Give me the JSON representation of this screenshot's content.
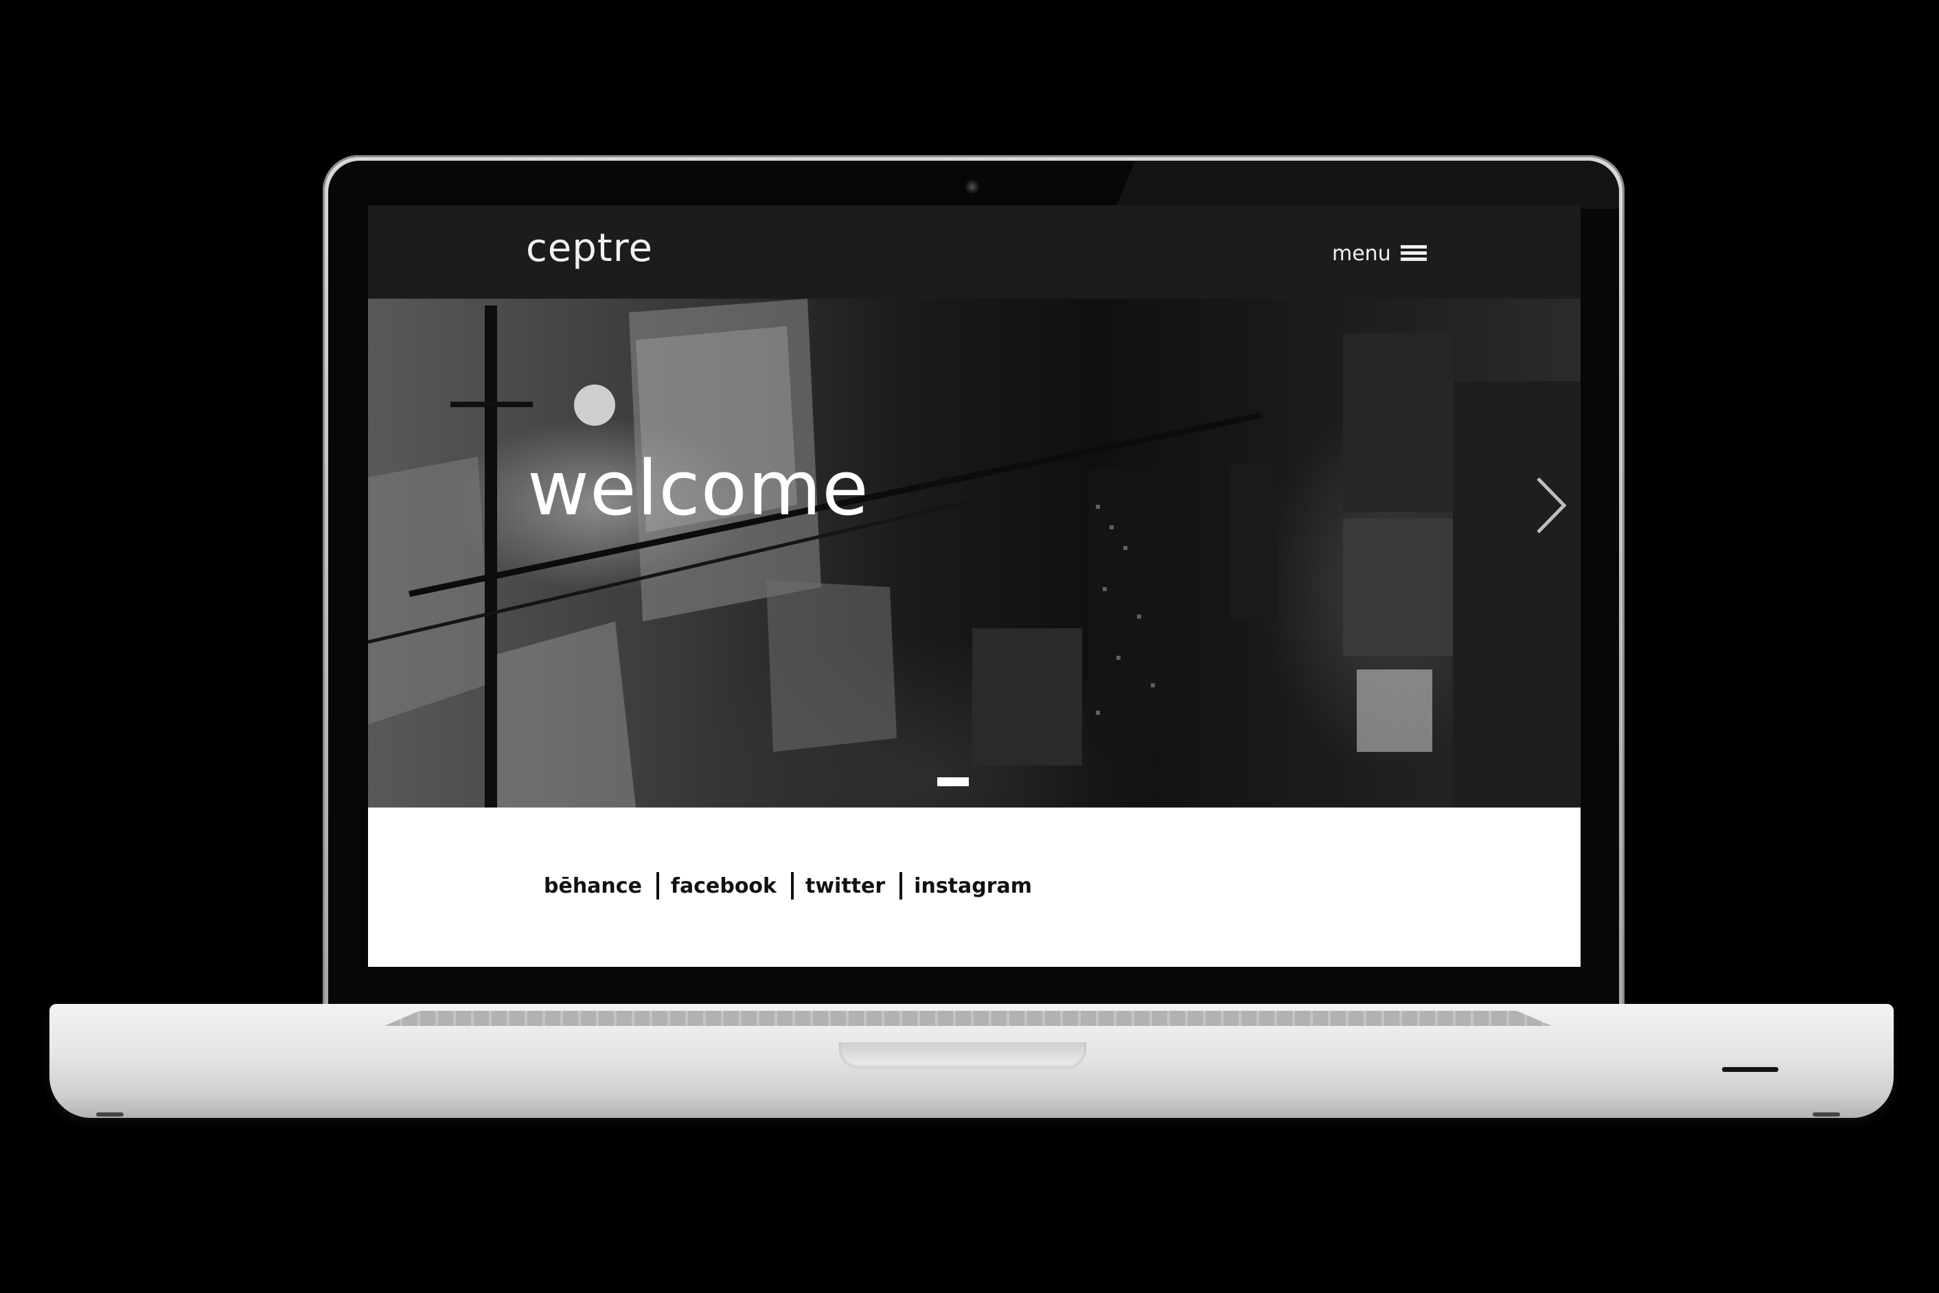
{
  "site": {
    "logo": "ceptre",
    "menu_label": "menu"
  },
  "hero": {
    "title": "welcome",
    "slide_indicator": {
      "current": 1,
      "total": 1
    }
  },
  "footer": {
    "links": [
      {
        "label": "bēhance"
      },
      {
        "label": "facebook"
      },
      {
        "label": "twitter"
      },
      {
        "label": "instagram"
      }
    ]
  },
  "icons": {
    "menu": "hamburger-icon",
    "next": "chevron-right-icon",
    "camera": "camera-icon"
  },
  "colors": {
    "background": "#000000",
    "topbar": "#1b1c1d",
    "footer": "#ffffff",
    "text_light": "#ffffff",
    "text_dark": "#111111"
  }
}
